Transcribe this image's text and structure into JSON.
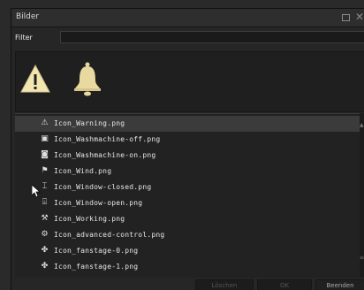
{
  "window": {
    "title": "Bilder",
    "restore_icon": "restore-icon",
    "close_icon": "close-icon",
    "close_glyph": "✕"
  },
  "filter": {
    "label": "Filter",
    "value": ""
  },
  "preview": {
    "icons": [
      "warning-icon",
      "bell-icon"
    ]
  },
  "list": {
    "selected_index": 0,
    "items": [
      {
        "label": "Icon_Warning.png",
        "icon": "warning-icon",
        "glyph": "⚠"
      },
      {
        "label": "Icon_Washmachine-off.png",
        "icon": "washmachine-off-icon",
        "glyph": "▣"
      },
      {
        "label": "Icon_Washmachine-on.png",
        "icon": "washmachine-on-icon",
        "glyph": "◙"
      },
      {
        "label": "Icon_Wind.png",
        "icon": "wind-icon",
        "glyph": "⚑"
      },
      {
        "label": "Icon_Window-closed.png",
        "icon": "window-closed-icon",
        "glyph": "⌶"
      },
      {
        "label": "Icon_Window-open.png",
        "icon": "window-open-icon",
        "glyph": "⌹"
      },
      {
        "label": "Icon_Working.png",
        "icon": "working-icon",
        "glyph": "⚒"
      },
      {
        "label": "Icon_advanced-control.png",
        "icon": "advanced-control-icon",
        "glyph": "⚙"
      },
      {
        "label": "Icon_fanstage-0.png",
        "icon": "fanstage-0-icon",
        "glyph": "✤"
      },
      {
        "label": "Icon_fanstage-1.png",
        "icon": "fanstage-1-icon",
        "glyph": "✤"
      }
    ]
  },
  "footer": {
    "delete_label": "Löschen",
    "ok_label": "OK",
    "close_label": "Beenden"
  },
  "colors": {
    "background": "#262626",
    "selected_row": "#3b3b3b",
    "icon_warning": "#f2e6b0",
    "icon_bell": "#e8d9a0"
  }
}
